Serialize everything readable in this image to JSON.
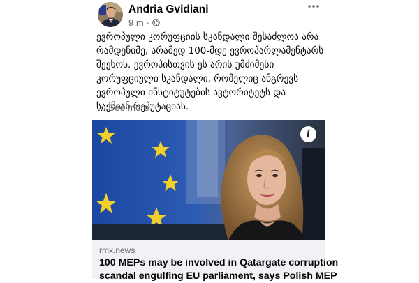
{
  "post": {
    "author": "Andria Gvidiani",
    "time": "9 m",
    "separator": "·",
    "privacy_icon": "globe-icon",
    "more_icon": "ellipsis-icon",
    "text_lines": [
      "ევროპული კორუფციის სკანდალი შესაძლოა არა",
      "რამდენიმე, არამედ 100-მდე ევროპარლამენტარს",
      "შეეხოს. ევროპისთვის ეს არის უმძიმესი",
      "კორუფციული სკანდალი, რომელიც ანგრევს",
      "ევროპული ინსტიტუტების ავტორიტეტს და",
      "საქმიან რეპუტაციას."
    ],
    "ellipsis": "...",
    "see_more": "See more"
  },
  "link_preview": {
    "domain": "rmx.news",
    "headline_lines": [
      "100 MEPs may be involved in Qatargate corruption",
      "scandal engulfing EU parliament, says Polish MEP"
    ],
    "info_icon": "info-icon",
    "info_label": "i"
  },
  "colors": {
    "author_text": "#050505",
    "meta_text": "#65676b",
    "card_footer_bg": "#f0f2f5",
    "eu_blue": "#1f4fa8",
    "eu_star": "#f2cf2a"
  }
}
